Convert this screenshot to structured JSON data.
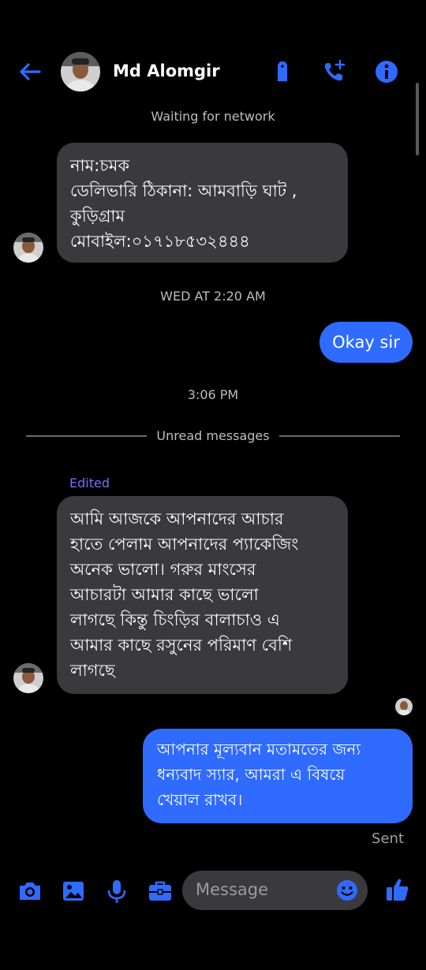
{
  "header": {
    "contact_name": "Md Alomgir"
  },
  "status": {
    "network": "Waiting for network"
  },
  "messages": {
    "incoming_1": [
      "নাম:চমক",
      "ডেলিভারি ঠিকানা: আমবাড়ি ঘাট ,",
      "কুড়িগ্রাম",
      "মোবাইল:০১৭১৮৫৩২৪৪৪"
    ],
    "timestamp_1": "WED AT 2:20 AM",
    "outgoing_1": "Okay sir",
    "timestamp_2": "3:06 PM",
    "unread_label": "Unread messages",
    "edited_label": "Edited",
    "incoming_2": [
      "আমি আজকে আপনাদের আচার",
      "হাতে পেলাম আপনাদের প্যাকেজিং",
      "অনেক ভালো। গরুর মাংসের",
      "আচারটা আমার কাছে ভালো",
      "লাগছে কিন্তু চিংড়ির বালাচাও এ",
      "আমার কাছে রসুনের পরিমাণ বেশি",
      "লাগছে"
    ],
    "outgoing_2": [
      "আপনার মূল্যবান মতামতের জন্য",
      "ধন্যবাদ স্যার, আমরা এ বিষয়ে",
      "খেয়াল রাখব।"
    ],
    "sent_label": "Sent"
  },
  "composer": {
    "placeholder": "Message"
  },
  "colors": {
    "accent": "#2f6bff",
    "bubble_in": "#3a3a3c",
    "edited": "#7b6bff",
    "background": "#000000"
  },
  "icons": [
    "back-arrow-icon",
    "tag-icon",
    "add-call-icon",
    "info-icon",
    "camera-icon",
    "image-icon",
    "mic-icon",
    "briefcase-icon",
    "emoji-icon",
    "thumbs-up-icon"
  ]
}
